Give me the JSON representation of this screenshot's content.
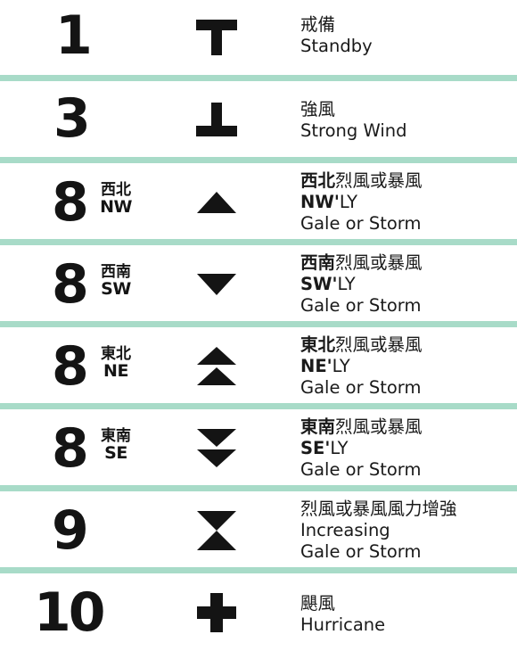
{
  "rows": [
    {
      "number": "1",
      "desc": {
        "line1": "戒備",
        "line2": "Standby"
      }
    },
    {
      "number": "3",
      "desc": {
        "line1": "強風",
        "line2": "Strong Wind"
      }
    },
    {
      "number": "8",
      "dir_zh": "西北",
      "dir_en": "NW",
      "desc": {
        "zh_bold": "西北",
        "zh_rest": "烈風或暴風",
        "en_bold": "NW'",
        "en_rest": "LY",
        "line3": "Gale or Storm"
      }
    },
    {
      "number": "8",
      "dir_zh": "西南",
      "dir_en": "SW",
      "desc": {
        "zh_bold": "西南",
        "zh_rest": "烈風或暴風",
        "en_bold": "SW'",
        "en_rest": "LY",
        "line3": "Gale or Storm"
      }
    },
    {
      "number": "8",
      "dir_zh": "東北",
      "dir_en": "NE",
      "desc": {
        "zh_bold": "東北",
        "zh_rest": "烈風或暴風",
        "en_bold": "NE'",
        "en_rest": "LY",
        "line3": "Gale or Storm"
      }
    },
    {
      "number": "8",
      "dir_zh": "東南",
      "dir_en": "SE",
      "desc": {
        "zh_bold": "東南",
        "zh_rest": "烈風或暴風",
        "en_bold": "SE'",
        "en_rest": "LY",
        "line3": "Gale or Storm"
      }
    },
    {
      "number": "9",
      "desc": {
        "line1": "烈風或暴風風力增強",
        "line2": "Increasing",
        "line3": "Gale or Storm"
      }
    },
    {
      "number": "10",
      "desc": {
        "line1": "颶風",
        "line2": "Hurricane"
      }
    }
  ],
  "colors": {
    "separator": "#a8dbc8",
    "symbol": "#141414"
  },
  "icons": [
    "t-signal-icon",
    "inverted-t-signal-icon",
    "triangle-up-icon",
    "triangle-down-icon",
    "double-triangle-up-icon",
    "double-triangle-down-icon",
    "hourglass-icon",
    "cross-icon"
  ]
}
